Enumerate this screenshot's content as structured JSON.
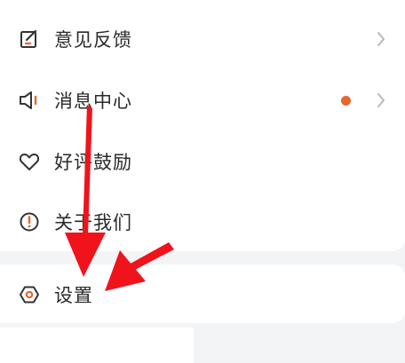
{
  "menu": {
    "items": [
      {
        "label": "意见反馈",
        "icon": "edit-icon",
        "has_chevron": true
      },
      {
        "label": "消息中心",
        "icon": "speaker-icon",
        "has_chevron": true,
        "has_badge": true
      },
      {
        "label": "好评鼓励",
        "icon": "heart-icon",
        "has_chevron": false
      },
      {
        "label": "关于我们",
        "icon": "info-icon",
        "has_chevron": false
      }
    ]
  },
  "settings": {
    "label": "设置",
    "icon": "settings-icon"
  },
  "colors": {
    "accent": "#e8652c",
    "annotation_arrow": "#f0131c",
    "icon": "#333333",
    "chevron": "#b8b8b8"
  }
}
